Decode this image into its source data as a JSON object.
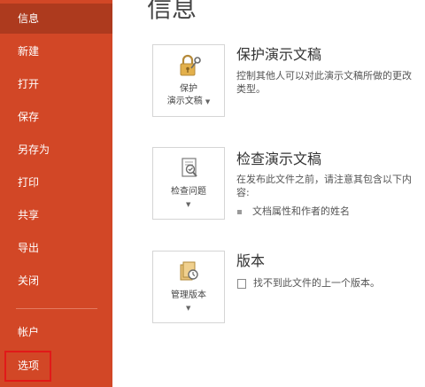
{
  "sidebar": {
    "items": [
      {
        "label": "信息"
      },
      {
        "label": "新建"
      },
      {
        "label": "打开"
      },
      {
        "label": "保存"
      },
      {
        "label": "另存为"
      },
      {
        "label": "打印"
      },
      {
        "label": "共享"
      },
      {
        "label": "导出"
      },
      {
        "label": "关闭"
      },
      {
        "label": "帐户"
      },
      {
        "label": "选项"
      }
    ]
  },
  "main": {
    "title": "信息",
    "sections": [
      {
        "button_line1": "保护",
        "button_line2": "演示文稿",
        "title": "保护演示文稿",
        "description": "控制其他人可以对此演示文稿所做的更改类型。"
      },
      {
        "button_label": "检查问题",
        "title": "检查演示文稿",
        "description": "在发布此文件之前，请注意其包含以下内容:",
        "bullet": "文档属性和作者的姓名"
      },
      {
        "button_label": "管理版本",
        "title": "版本",
        "bullet": "找不到此文件的上一个版本。"
      }
    ]
  },
  "colors": {
    "sidebar_bg": "#d24726",
    "sidebar_active": "#ad3a1e",
    "highlight_box": "#e11919"
  }
}
